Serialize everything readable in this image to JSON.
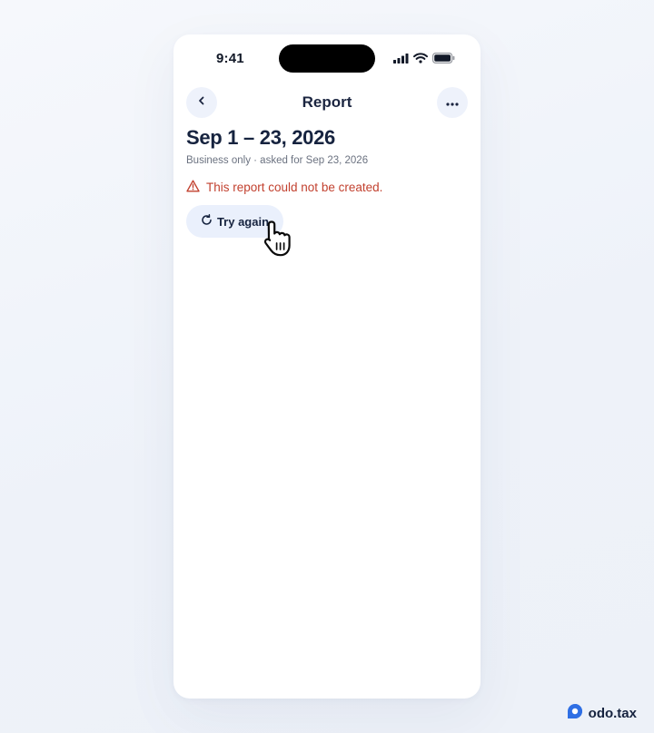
{
  "status_bar": {
    "time": "9:41"
  },
  "nav": {
    "title": "Report"
  },
  "report": {
    "date_range": "Sep 1 – 23, 2026",
    "subtitle": "Business only · asked for Sep 23, 2026",
    "error_message": "This report could not be created.",
    "retry_label": "Try again"
  },
  "brand": {
    "name": "odo.tax"
  },
  "colors": {
    "accent": "#2f6fe4",
    "error": "#c2412f",
    "button_bg": "#eaf0fc",
    "title": "#16233f"
  },
  "icons": {
    "back": "chevron-left-icon",
    "more": "more-horizontal-icon",
    "error": "warning-triangle-icon",
    "retry": "refresh-icon",
    "cursor": "hand-pointer-icon"
  }
}
